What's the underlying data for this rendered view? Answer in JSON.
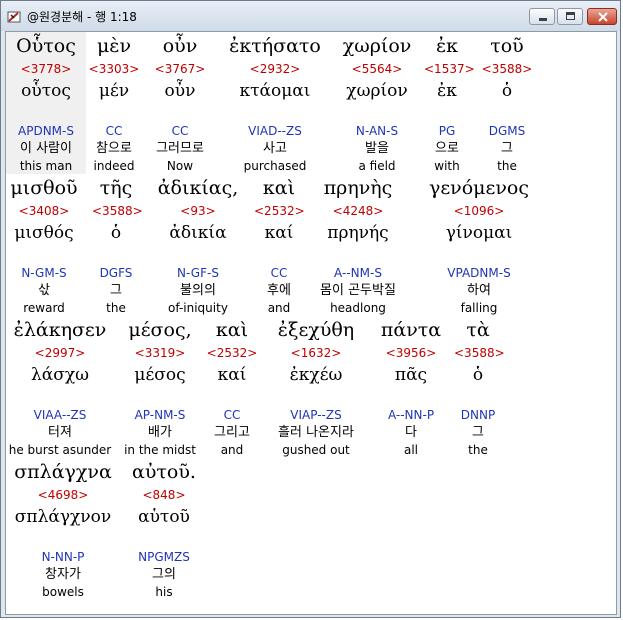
{
  "window": {
    "title": "@원경분해 - 행 1:18",
    "colors": {
      "strong": "#c00000",
      "parse": "#1f35b8",
      "highlight": "#f0f0f0"
    }
  },
  "rows": [
    [
      {
        "greek": "Οὗτος",
        "strong": "<3778>",
        "lemma": "οὗτος",
        "parse": "APDNM-S",
        "korean": "이 사람이",
        "english": "this man"
      },
      {
        "greek": "μὲν",
        "strong": "<3303>",
        "lemma": "μέν",
        "parse": "CC",
        "korean": "참으로",
        "english": "indeed"
      },
      {
        "greek": "οὖν",
        "strong": "<3767>",
        "lemma": "οὖν",
        "parse": "CC",
        "korean": "그러므로",
        "english": "Now"
      },
      {
        "greek": "ἐκτήσατο",
        "strong": "<2932>",
        "lemma": "κτάομαι",
        "parse": "VIAD--ZS",
        "korean": "사고",
        "english": "purchased"
      },
      {
        "greek": "χωρίον",
        "strong": "<5564>",
        "lemma": "χωρίον",
        "parse": "N-AN-S",
        "korean": "발을",
        "english": "a field"
      },
      {
        "greek": "ἐκ",
        "strong": "<1537>",
        "lemma": "ἐκ",
        "parse": "PG",
        "korean": "으로",
        "english": "with"
      },
      {
        "greek": "τοῦ",
        "strong": "<3588>",
        "lemma": "ὁ",
        "parse": "DGMS",
        "korean": "그",
        "english": "the"
      }
    ],
    [
      {
        "greek": "μισθοῦ",
        "strong": "<3408>",
        "lemma": "μισθός",
        "parse": "N-GM-S",
        "korean": "삯",
        "english": "reward"
      },
      {
        "greek": "τῆς",
        "strong": "<3588>",
        "lemma": "ὁ",
        "parse": "DGFS",
        "korean": "그",
        "english": "the"
      },
      {
        "greek": "ἀδικίας,",
        "strong": "<93>",
        "lemma": "ἀδικία",
        "parse": "N-GF-S",
        "korean": "불의의",
        "english": "of-iniquity"
      },
      {
        "greek": "καὶ",
        "strong": "<2532>",
        "lemma": "καί",
        "parse": "CC",
        "korean": "후에",
        "english": "and"
      },
      {
        "greek": "πρηνὴς",
        "strong": "<4248>",
        "lemma": "πρηνής",
        "parse": "A--NM-S",
        "korean": "몸이 곤두박질",
        "english": "headlong"
      },
      {
        "greek": "γενόμενος",
        "strong": "<1096>",
        "lemma": "γίνομαι",
        "parse": "VPADNM-S",
        "korean": "하여",
        "english": "falling"
      }
    ],
    [
      {
        "greek": "ἐλάκησεν",
        "strong": "<2997>",
        "lemma": "λάσχω",
        "parse": "VIAA--ZS",
        "korean": "터져",
        "english": "he burst asunder"
      },
      {
        "greek": "μέσος,",
        "strong": "<3319>",
        "lemma": "μέσος",
        "parse": "AP-NM-S",
        "korean": "배가",
        "english": "in the midst"
      },
      {
        "greek": "καὶ",
        "strong": "<2532>",
        "lemma": "καί",
        "parse": "CC",
        "korean": "그리고",
        "english": "and"
      },
      {
        "greek": "ἐξεχύθη",
        "strong": "<1632>",
        "lemma": "ἐκχέω",
        "parse": "VIAP--ZS",
        "korean": "흘러 나온지라",
        "english": "gushed out"
      },
      {
        "greek": "πάντα",
        "strong": "<3956>",
        "lemma": "πᾶς",
        "parse": "A--NN-P",
        "korean": "다",
        "english": "all"
      },
      {
        "greek": "τὰ",
        "strong": "<3588>",
        "lemma": "ὁ",
        "parse": "DNNP",
        "korean": "그",
        "english": "the"
      }
    ],
    [
      {
        "greek": "σπλάγχνα",
        "strong": "<4698>",
        "lemma": "σπλάγχνον",
        "parse": "N-NN-P",
        "korean": "창자가",
        "english": "bowels"
      },
      {
        "greek": "αὐτοῦ.",
        "strong": "<848>",
        "lemma": "αὑτοῦ",
        "parse": "NPGMZS",
        "korean": "그의",
        "english": "his"
      }
    ]
  ]
}
